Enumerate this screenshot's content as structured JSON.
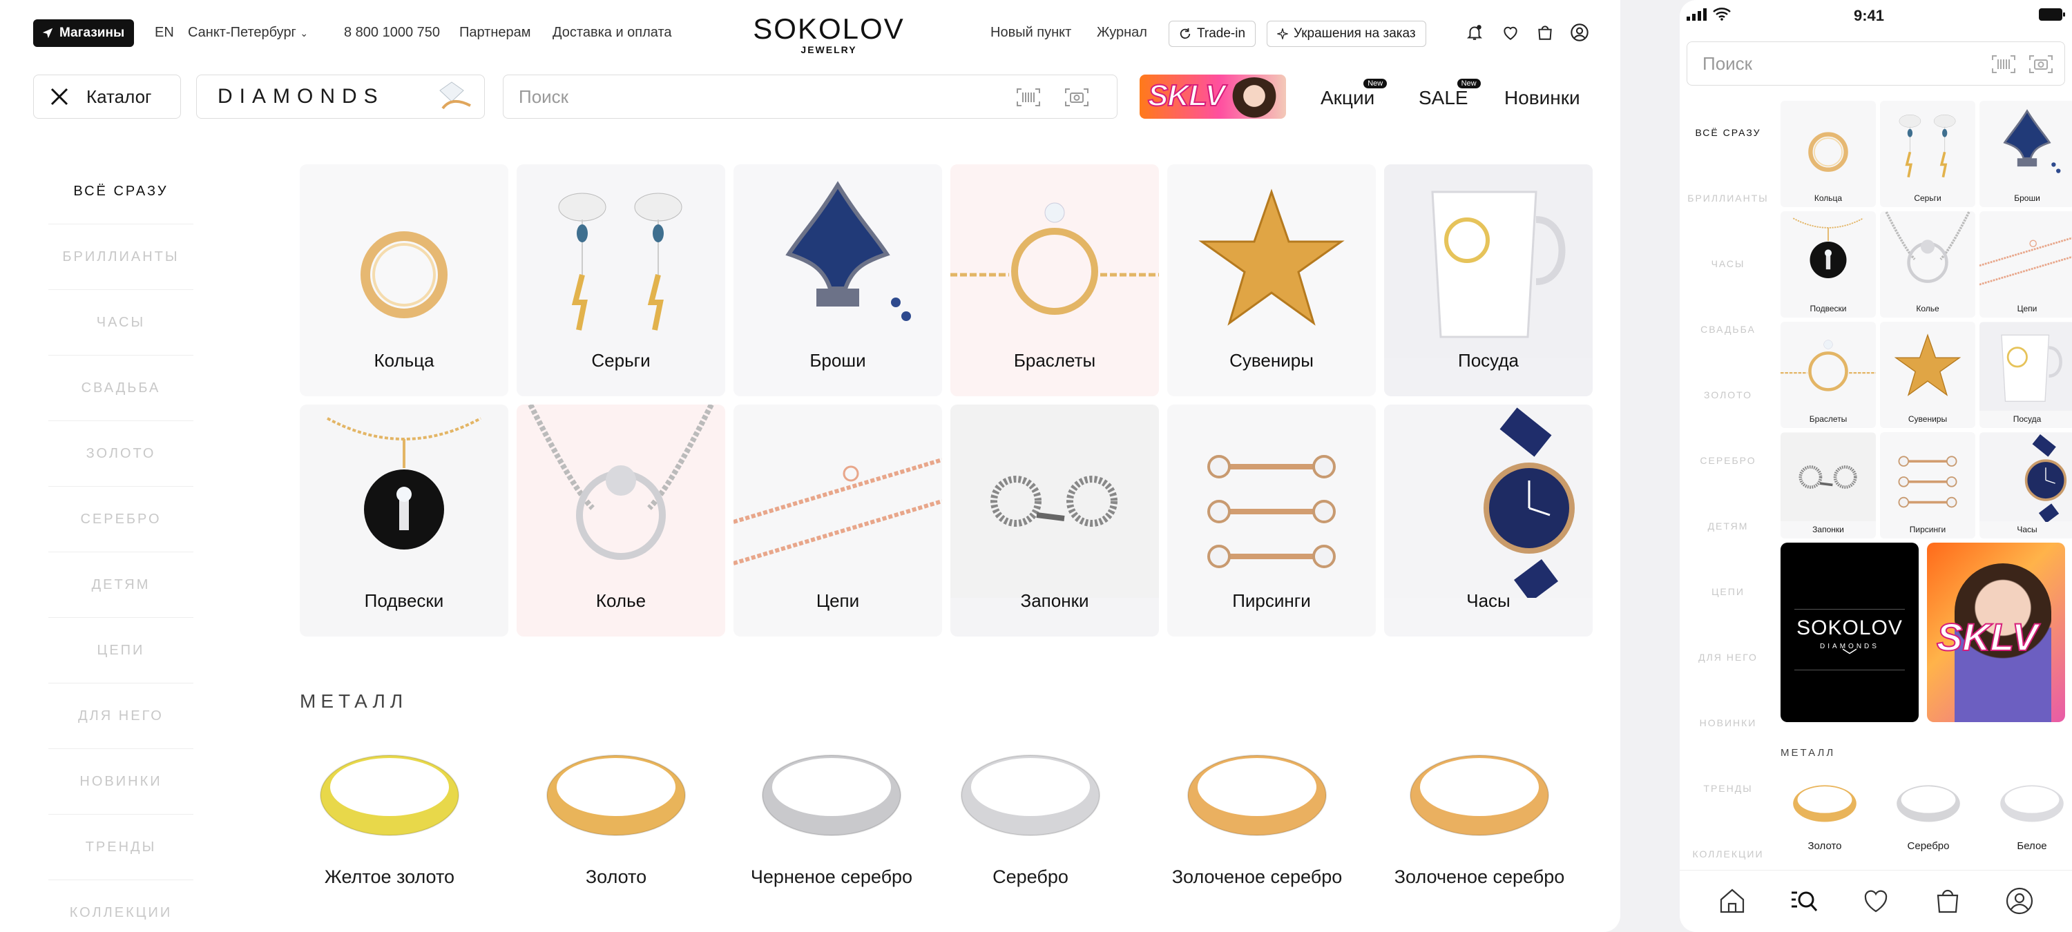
{
  "header": {
    "stores_label": "Магазины",
    "lang": "EN",
    "city": "Санкт-Петербург",
    "phone": "8 800 1000 750",
    "partners": "Партнерам",
    "delivery": "Доставка и оплата",
    "logo_main": "SOKOLOV",
    "logo_sub": "JEWELRY",
    "new_point": "Новый пункт",
    "journal": "Журнал",
    "tradein": "Trade-in",
    "custom": "Украшения на заказ"
  },
  "nav": {
    "catalog": "Каталог",
    "diamonds": "DIAMONDS",
    "search_placeholder": "Поиск",
    "sklv": "SKLV",
    "promo": "Акции",
    "sale": "SALE",
    "new_badge": "New",
    "novelties": "Новинки"
  },
  "sidebar": {
    "items": [
      "ВСЁ СРАЗУ",
      "БРИЛЛИАНТЫ",
      "ЧАСЫ",
      "СВАДЬБА",
      "ЗОЛОТО",
      "СЕРЕБРО",
      "ДЕТЯМ",
      "ЦЕПИ",
      "ДЛЯ НЕГО",
      "НОВИНКИ",
      "ТРЕНДЫ",
      "КОЛЛЕКЦИИ"
    ]
  },
  "categories": [
    {
      "label": "Кольца",
      "icon": "ring-icon"
    },
    {
      "label": "Серьги",
      "icon": "earrings-icon"
    },
    {
      "label": "Броши",
      "icon": "brooch-icon"
    },
    {
      "label": "Браслеты",
      "icon": "bracelet-icon"
    },
    {
      "label": "Сувениры",
      "icon": "star-icon"
    },
    {
      "label": "Посуда",
      "icon": "cup-icon"
    },
    {
      "label": "Подвески",
      "icon": "pendant-icon"
    },
    {
      "label": "Колье",
      "icon": "necklace-icon"
    },
    {
      "label": "Цепи",
      "icon": "chain-icon"
    },
    {
      "label": "Запонки",
      "icon": "cufflinks-icon"
    },
    {
      "label": "Пирсинги",
      "icon": "piercing-icon"
    },
    {
      "label": "Часы",
      "icon": "watch-icon"
    }
  ],
  "metal": {
    "title": "МЕТАЛЛ",
    "items": [
      {
        "label": "Желтое золото",
        "color": "#e8d84a"
      },
      {
        "label": "Золото",
        "color": "#e9b45a"
      },
      {
        "label": "Черненое серебро",
        "color": "#c9c9cc"
      },
      {
        "label": "Серебро",
        "color": "#d5d5d8"
      },
      {
        "label": "Золоченое серебро",
        "color": "#eab060"
      },
      {
        "label": "Золоченое серебро",
        "color": "#eab060"
      }
    ]
  },
  "phone": {
    "time": "9:41",
    "search_placeholder": "Поиск",
    "sidebar": [
      "ВСЁ СРАЗУ",
      "БРИЛЛИАНТЫ",
      "ЧАСЫ",
      "СВАДЬБА",
      "ЗОЛОТО",
      "СЕРЕБРО",
      "ДЕТЯМ",
      "ЦЕПИ",
      "ДЛЯ НЕГО",
      "НОВИНКИ",
      "ТРЕНДЫ",
      "КОЛЛЕКЦИИ"
    ],
    "tiles": [
      "Кольца",
      "Серьги",
      "Броши",
      "Подвески",
      "Колье",
      "Цепи",
      "Браслеты",
      "Сувениры",
      "Посуда",
      "Запонки",
      "Пирсинги",
      "Часы"
    ],
    "banner_logo": "SOKOLOV",
    "banner_sub": "DIAMONDS",
    "banner_sklv": "SKLV",
    "metal_title": "МЕТАЛЛ",
    "metal": [
      "Золото",
      "Серебро",
      "Белое"
    ]
  }
}
